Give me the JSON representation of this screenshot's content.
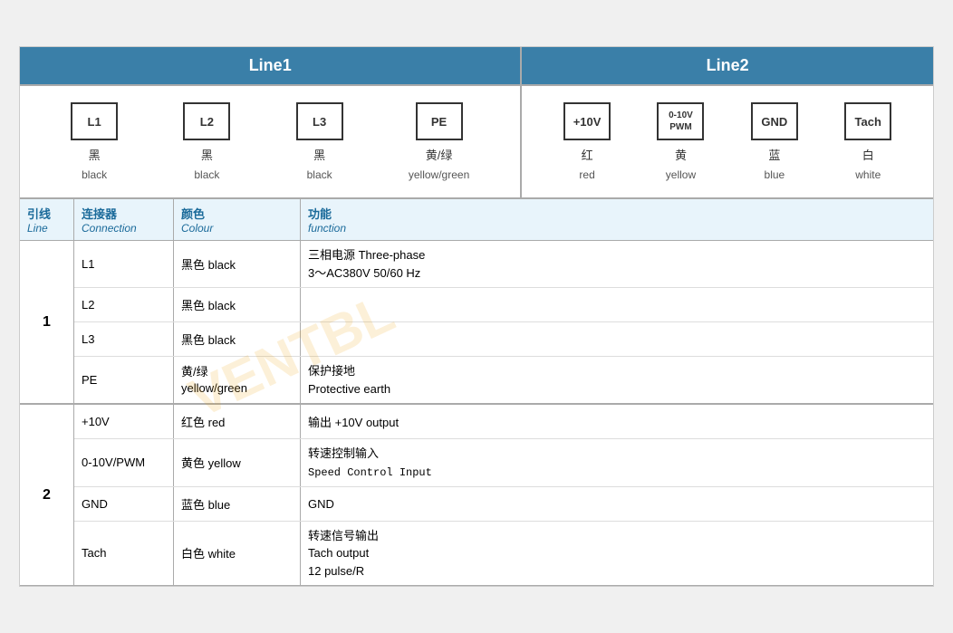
{
  "header": {
    "line1_label": "Line1",
    "line2_label": "Line2"
  },
  "line1_connectors": [
    {
      "id": "l1-L1",
      "box_label": "L1",
      "cn": "黑",
      "en": "black"
    },
    {
      "id": "l1-L2",
      "box_label": "L2",
      "cn": "黑",
      "en": "black"
    },
    {
      "id": "l1-L3",
      "box_label": "L3",
      "cn": "黑",
      "en": "black"
    },
    {
      "id": "l1-PE",
      "box_label": "PE",
      "cn": "黄/绿",
      "en": "yellow/green"
    }
  ],
  "line2_connectors": [
    {
      "id": "l2-10V",
      "box_label": "+10V",
      "cn": "红",
      "en": "red"
    },
    {
      "id": "l2-PWM",
      "box_label": "0-10V\nPWM",
      "cn": "黄",
      "en": "yellow",
      "small": true
    },
    {
      "id": "l2-GND",
      "box_label": "GND",
      "cn": "蓝",
      "en": "blue"
    },
    {
      "id": "l2-Tach",
      "box_label": "Tach",
      "cn": "白",
      "en": "white"
    }
  ],
  "table_headers": {
    "line_cn": "引线",
    "line_en": "Line",
    "conn_cn": "连接器",
    "conn_en": "Connection",
    "color_cn": "颜色",
    "color_en": "Colour",
    "func_cn": "功能",
    "func_en": "function"
  },
  "section1": {
    "line_number": "1",
    "rows": [
      {
        "connector": "L1",
        "color_cn": "黑色 black",
        "func": "三相电源 Three-phase\n3～AC380V 50/60 Hz"
      },
      {
        "connector": "L2",
        "color_cn": "黑色 black",
        "func": ""
      },
      {
        "connector": "L3",
        "color_cn": "黑色 black",
        "func": ""
      },
      {
        "connector": "PE",
        "color_cn": "黄/绿\nyellow/green",
        "func": "保护接地\nProtective earth"
      }
    ]
  },
  "section2": {
    "line_number": "2",
    "rows": [
      {
        "connector": "+10V",
        "color_cn": "红色 red",
        "func": "输出 +10V output"
      },
      {
        "connector": "0-10V/PWM",
        "color_cn": "黄色 yellow",
        "func": "转速控制输入\nSpeed Control Input",
        "func_mono": true
      },
      {
        "connector": "GND",
        "color_cn": "蓝色 blue",
        "func": "GND"
      },
      {
        "connector": "Tach",
        "color_cn": "白色 white",
        "func": "转速信号输出\nTach output\n12 pulse/R"
      }
    ]
  },
  "watermark": "VENTBL"
}
